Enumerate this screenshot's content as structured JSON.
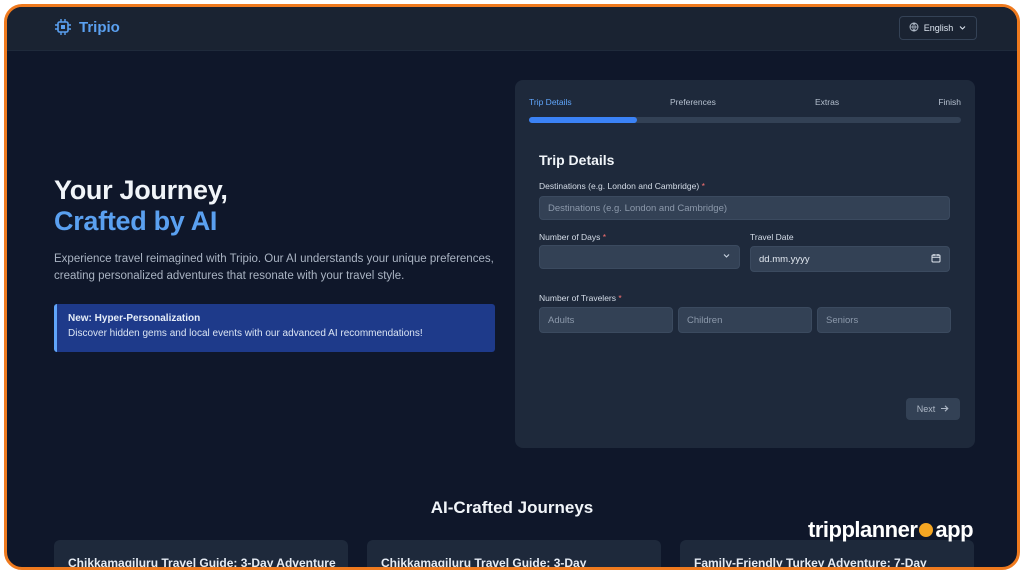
{
  "app": {
    "name": "Tripio"
  },
  "header": {
    "language": "English"
  },
  "hero": {
    "title_line1": "Your Journey,",
    "title_line2": "Crafted by AI",
    "description": "Experience travel reimagined with Tripio. Our AI understands your unique preferences, creating personalized adventures that resonate with your travel style."
  },
  "banner": {
    "title": "New: Hyper-Personalization",
    "text": "Discover hidden gems and local events with our advanced AI recommendations!"
  },
  "wizard": {
    "steps": [
      "Trip Details",
      "Preferences",
      "Extras",
      "Finish"
    ],
    "active_step": 0,
    "progress": 0.25,
    "title": "Trip Details",
    "destinations_label": "Destinations (e.g. London and Cambridge)",
    "destinations_placeholder": "Destinations (e.g. London and Cambridge)",
    "days_label": "Number of Days",
    "days_value": "",
    "date_label": "Travel Date",
    "date_value": "dd.mm.yyyy",
    "travelers_label": "Number of Travelers",
    "adults_placeholder": "Adults",
    "children_placeholder": "Children",
    "seniors_placeholder": "Seniors",
    "required_mark": "*",
    "next_label": "Next"
  },
  "journeys": {
    "title": "AI-Crafted Journeys",
    "items": [
      "Chikkamagiluru Travel Guide: 3-Day Adventure",
      "Chikkamagiluru Travel Guide: 3-Day",
      "Family-Friendly Turkey Adventure: 7-Day"
    ]
  },
  "watermark": {
    "part1": "tripplanner",
    "part2": "app"
  },
  "colors": {
    "accent": "#5aa0f0",
    "frame": "#ef7a1e",
    "background": "#0f172a",
    "card": "#1e293b"
  }
}
